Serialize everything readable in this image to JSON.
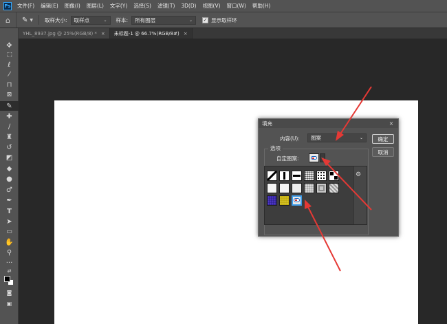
{
  "app": {
    "logo_text": "Ps"
  },
  "menu": [
    "文件(F)",
    "编辑(E)",
    "图像(I)",
    "图层(L)",
    "文字(Y)",
    "选择(S)",
    "滤镜(T)",
    "3D(D)",
    "视图(V)",
    "窗口(W)",
    "帮助(H)"
  ],
  "options_bar": {
    "sample_size_label": "取样大小:",
    "sample_size_value": "取样点",
    "sample_label": "样本:",
    "sample_value": "所有图层",
    "show_ring_label": "显示取样环",
    "show_ring_checked": true
  },
  "tabs": [
    {
      "label": "YHL_8937.jpg @ 25%(RGB/8) *",
      "active": false,
      "close": "×"
    },
    {
      "label": "未标题-1 @ 66.7%(RGB/8#)",
      "active": true,
      "close": "×"
    }
  ],
  "fill_dialog": {
    "title": "填充",
    "close": "×",
    "contents_label": "内容(U):",
    "contents_value": "图案",
    "options_label": "选项",
    "custom_pattern_label": "自定图案:",
    "ok_label": "确定",
    "cancel_label": "取消",
    "gear": "⚙"
  },
  "colors": {
    "arrow": "#e53935",
    "selection": "#3d9be9"
  }
}
